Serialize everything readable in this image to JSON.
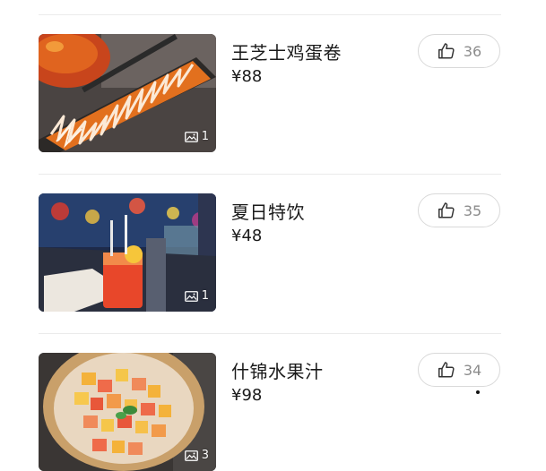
{
  "dishes": [
    {
      "name": "王芝士鸡蛋卷",
      "price": "¥88",
      "photo_count": "1",
      "likes": "36",
      "thumbnail_icon": "photo-icon"
    },
    {
      "name": "夏日特饮",
      "price": "¥48",
      "photo_count": "1",
      "likes": "35",
      "thumbnail_icon": "photo-icon"
    },
    {
      "name": "什锦水果汁",
      "price": "¥98",
      "photo_count": "3",
      "likes": "34",
      "thumbnail_icon": "photo-icon"
    }
  ],
  "icons": {
    "like": "thumbs-up-icon",
    "photo": "image-icon"
  },
  "colors": {
    "divider": "#ebebeb",
    "like_border": "#d9d9d9",
    "like_count": "#8c8c8c",
    "text": "#1a1a1a"
  }
}
